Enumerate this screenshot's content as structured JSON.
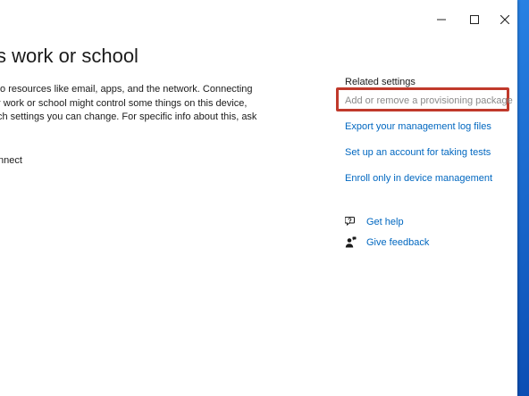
{
  "window": {
    "page_title": "s work or school",
    "controls": {
      "minimize": "—",
      "maximize": "☐",
      "close": "✕"
    }
  },
  "main": {
    "description_lines": [
      "to resources like email, apps, and the network. Connecting",
      "r work or school might control some things on this device,",
      "ch settings you can change. For specific info about this, ask"
    ],
    "connect_label": "nnect"
  },
  "related": {
    "title": "Related settings",
    "links": {
      "provisioning": "Add or remove a provisioning package",
      "export_logs": "Export your management log files",
      "test_account": "Set up an account for taking tests",
      "enroll": "Enroll only in device management"
    }
  },
  "support": {
    "get_help": "Get help",
    "give_feedback": "Give feedback"
  },
  "colors": {
    "link": "#0067c0",
    "highlight": "#c0392b",
    "desktop": "#1e6fd9"
  }
}
